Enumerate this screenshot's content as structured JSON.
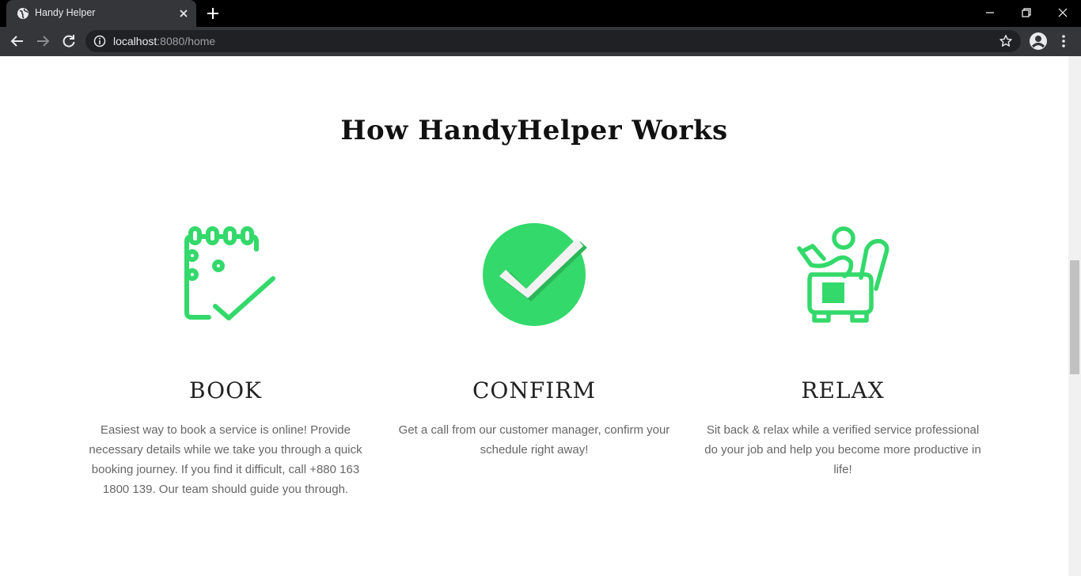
{
  "browser": {
    "tab_title": "Handy Helper",
    "url_host": "localhost",
    "url_path": ":8080/home"
  },
  "colors": {
    "accent": "#33d96a",
    "title_text": "#111111",
    "body_text": "#666666",
    "chrome_dark": "#35363a"
  },
  "section": {
    "title": "How HandyHelper Works"
  },
  "features": [
    {
      "icon": "calendar-check-icon",
      "heading": "BOOK",
      "text": "Easiest way to book a service is online! Provide necessary details while we take you through a quick booking journey. If you find it difficult, call +880 163 1800 139. Our team should guide you through."
    },
    {
      "icon": "check-circle-icon",
      "heading": "CONFIRM",
      "text": "Get a call from our customer manager, confirm your schedule right away!"
    },
    {
      "icon": "relax-chair-icon",
      "heading": "RELAX",
      "text": "Sit back & relax while a verified service professional do your job and help you become more productive in life!"
    }
  ]
}
